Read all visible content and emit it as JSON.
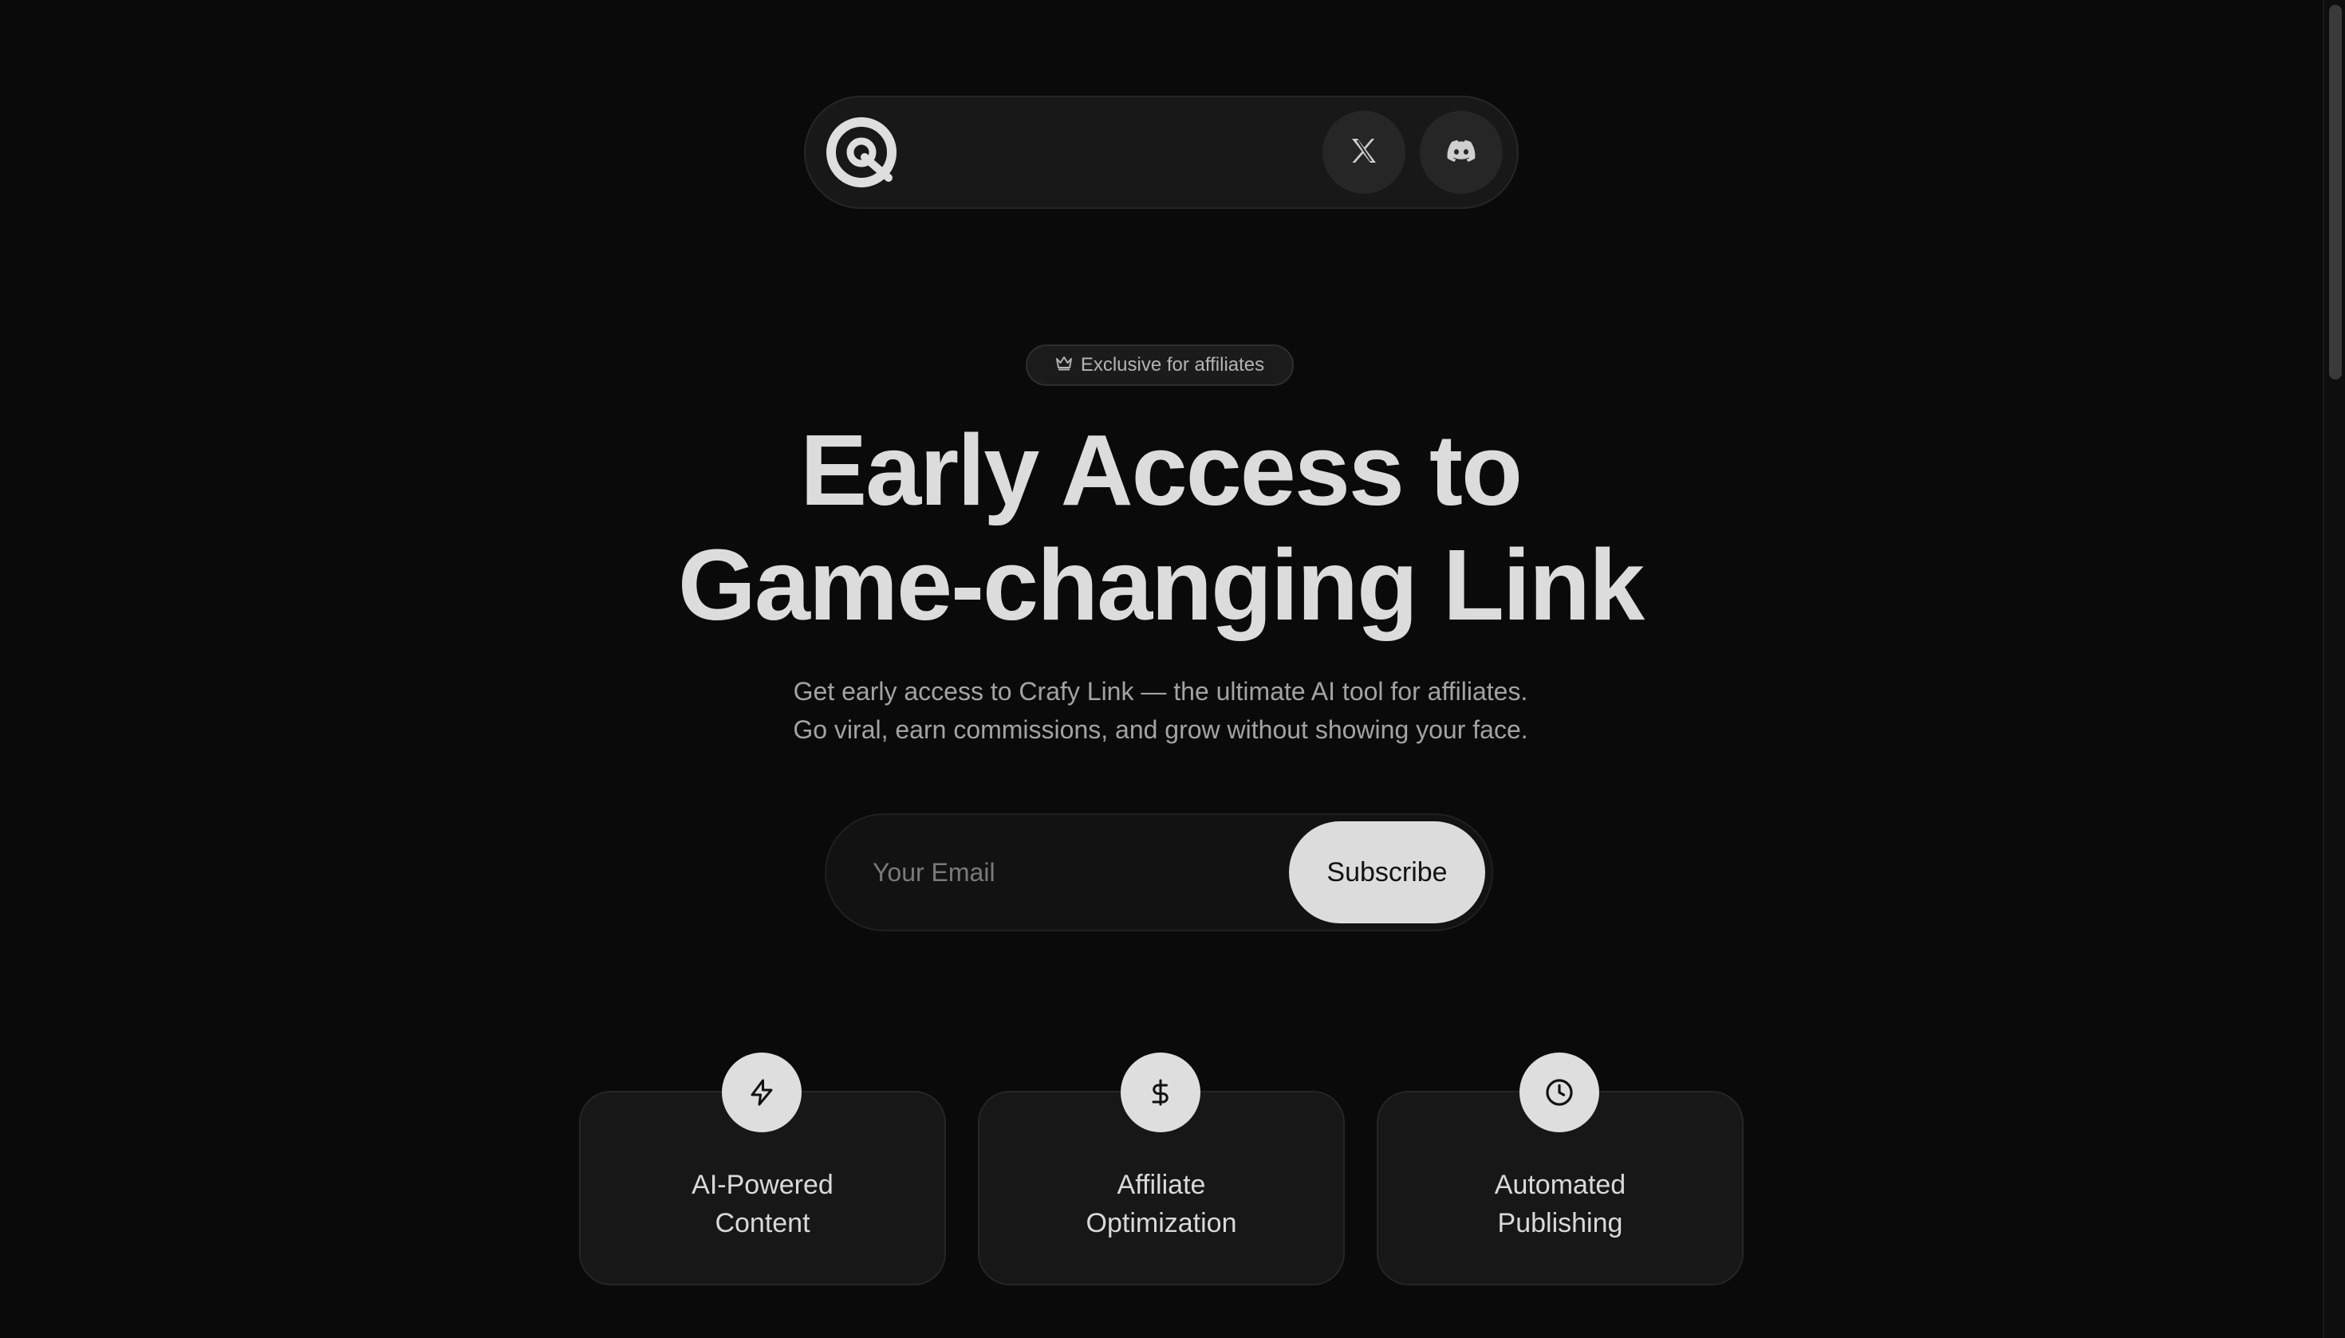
{
  "nav": {
    "logo_icon": "crafy-link-logo",
    "buttons": [
      {
        "icon": "x-twitter-icon",
        "label": "X"
      },
      {
        "icon": "discord-icon",
        "label": "Discord"
      }
    ]
  },
  "badge": {
    "icon": "crown-icon",
    "text": "Exclusive for affiliates"
  },
  "hero": {
    "title_line1": "Early Access to",
    "title_line2": "Game-changing Link",
    "subtitle_line1": "Get early access to Crafy Link — the ultimate AI tool for affiliates.",
    "subtitle_line2": "Go viral, earn commissions, and grow without showing your face."
  },
  "form": {
    "email_placeholder": "Your Email",
    "email_value": "",
    "subscribe_label": "Subscribe"
  },
  "features": [
    {
      "icon": "lightning-bolt-icon",
      "line1": "AI-Powered",
      "line2": "Content"
    },
    {
      "icon": "dollar-sign-icon",
      "line1": "Affiliate",
      "line2": "Optimization"
    },
    {
      "icon": "clock-icon",
      "line1": "Automated",
      "line2": "Publishing"
    }
  ],
  "colors": {
    "background": "#0a0a0a",
    "surface": "#181818",
    "accent_light": "#dcdcdc",
    "text_muted": "#a3a3a3"
  }
}
